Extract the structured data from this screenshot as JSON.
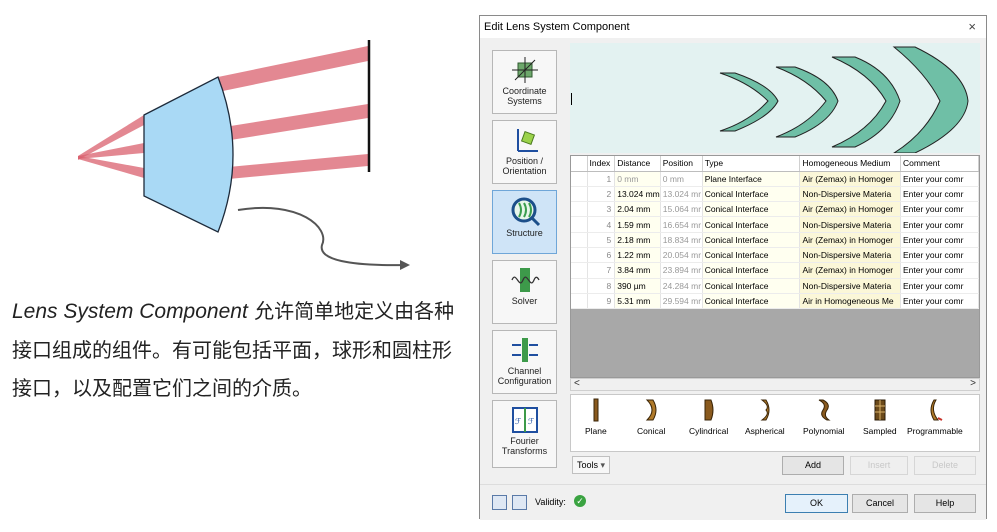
{
  "caption": {
    "italic": "Lens System Component",
    "text": " 允许简单地定义由各种接口组成的组件。有可能包括平面，球形和圆柱形接口，以及配置它们之间的介质。"
  },
  "dialog": {
    "title": "Edit Lens System Component",
    "close": "×",
    "sidebar": [
      {
        "label": "Coordinate Systems",
        "icon": "coordinate-axes-icon",
        "active": false
      },
      {
        "label": "Position / Orientation",
        "icon": "position-orientation-icon",
        "active": false
      },
      {
        "label": "Structure",
        "icon": "structure-lens-icon",
        "active": true
      },
      {
        "label": "Solver",
        "icon": "solver-icon",
        "active": false
      },
      {
        "label": "Channel Configuration",
        "icon": "channel-configuration-icon",
        "active": false
      },
      {
        "label": "Fourier Transforms",
        "icon": "fourier-transform-icon",
        "active": false
      }
    ],
    "table": {
      "headers": [
        "Index",
        "Distance",
        "Position",
        "Type",
        "Homogeneous Medium",
        "Comment"
      ],
      "rows": [
        [
          "1",
          "0 mm",
          "0 mm",
          "Plane Interface",
          "Air (Zemax) in Homoger",
          "Enter your comr"
        ],
        [
          "2",
          "13.024 mm",
          "13.024 mr",
          "Conical Interface",
          "Non-Dispersive Materia",
          "Enter your comr"
        ],
        [
          "3",
          "2.04 mm",
          "15.064 mr",
          "Conical Interface",
          "Air (Zemax) in Homoger",
          "Enter your comr"
        ],
        [
          "4",
          "1.59 mm",
          "16.654 mr",
          "Conical Interface",
          "Non-Dispersive Materia",
          "Enter your comr"
        ],
        [
          "5",
          "2.18 mm",
          "18.834 mr",
          "Conical Interface",
          "Air (Zemax) in Homoger",
          "Enter your comr"
        ],
        [
          "6",
          "1.22 mm",
          "20.054 mr",
          "Conical Interface",
          "Non-Dispersive Materia",
          "Enter your comr"
        ],
        [
          "7",
          "3.84 mm",
          "23.894 mr",
          "Conical Interface",
          "Air (Zemax) in Homoger",
          "Enter your comr"
        ],
        [
          "8",
          "390 µm",
          "24.284 mr",
          "Conical Interface",
          "Non-Dispersive Materia",
          "Enter your comr"
        ],
        [
          "9",
          "5.31 mm",
          "29.594 mr",
          "Conical Interface",
          "Air in Homogeneous Me",
          "Enter your comr"
        ]
      ]
    },
    "scroll": {
      "left": "<",
      "right": ">"
    },
    "palette": [
      "Plane",
      "Conical",
      "Cylindrical",
      "Aspherical",
      "Polynomial",
      "Sampled",
      "Programmable"
    ],
    "tools_label": "Tools",
    "buttons": {
      "add": "Add",
      "insert": "Insert",
      "delete": "Delete",
      "ok": "OK",
      "cancel": "Cancel",
      "help": "Help"
    },
    "validity_label": "Validity:",
    "colors": {
      "lens": "#6fbfa6",
      "preview_bg": "#e3f2f1",
      "beam": "#d9606e",
      "lens_illus": "#a9d9f5"
    }
  }
}
